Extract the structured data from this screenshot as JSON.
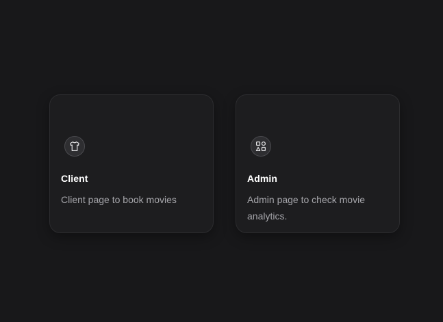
{
  "cards": [
    {
      "title": "Client",
      "description": "Client page to book movies",
      "icon": "shirt-icon"
    },
    {
      "title": "Admin",
      "description": "Admin page to check movie analytics.",
      "icon": "shapes-icon"
    }
  ],
  "colors": {
    "background": "#18181a",
    "card": "#1d1d1f",
    "title": "#ffffff",
    "description": "#a5a5aa"
  }
}
